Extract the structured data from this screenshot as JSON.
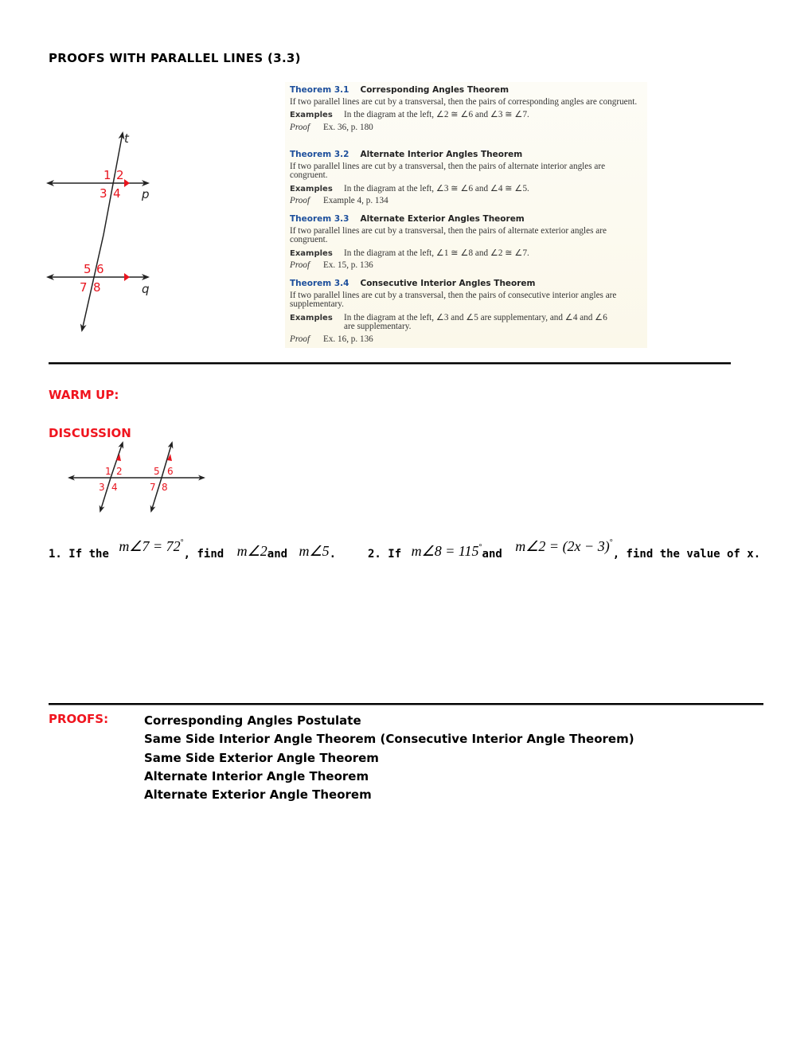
{
  "title": "PROOFS WITH PARALLEL LINES (3.3)",
  "diagram_main": {
    "transversal_label": "t",
    "line_labels": [
      "p",
      "q"
    ],
    "angle_labels": [
      "1",
      "2",
      "3",
      "4",
      "5",
      "6",
      "7",
      "8"
    ]
  },
  "theorems": [
    {
      "number": "Theorem 3.1",
      "name": "Corresponding Angles Theorem",
      "statement": "If two parallel lines are cut by a transversal, then the pairs of corresponding angles are congruent.",
      "examples_label": "Examples",
      "examples": "In the diagram at the left, ∠2 ≅ ∠6 and ∠3 ≅ ∠7.",
      "proof_label": "Proof",
      "proof": "Ex. 36, p. 180"
    },
    {
      "number": "Theorem 3.2",
      "name": "Alternate Interior Angles Theorem",
      "statement": "If two parallel lines are cut by a transversal, then the pairs of alternate interior angles are congruent.",
      "examples_label": "Examples",
      "examples": "In the diagram at the left, ∠3 ≅ ∠6 and ∠4 ≅ ∠5.",
      "proof_label": "Proof",
      "proof": "Example 4, p. 134"
    },
    {
      "number": "Theorem 3.3",
      "name": "Alternate Exterior Angles Theorem",
      "statement": "If two parallel lines are cut by a transversal, then the pairs of alternate exterior angles are congruent.",
      "examples_label": "Examples",
      "examples": "In the diagram at the left, ∠1 ≅ ∠8 and ∠2 ≅ ∠7.",
      "proof_label": "Proof",
      "proof": "Ex. 15, p. 136"
    },
    {
      "number": "Theorem 3.4",
      "name": "Consecutive Interior Angles Theorem",
      "statement": "If two parallel lines are cut by a transversal, then the pairs of consecutive interior angles are supplementary.",
      "examples_label": "Examples",
      "examples": "In the diagram at the left, ∠3 and ∠5 are supplementary, and ∠4 and ∠6 are supplementary.",
      "proof_label": "Proof",
      "proof": "Ex. 16, p. 136"
    }
  ],
  "warm_up": {
    "label": "WARM UP:"
  },
  "discussion": {
    "label": "DISCUSSION",
    "angle_labels": [
      "1",
      "2",
      "3",
      "4",
      "5",
      "6",
      "7",
      "8"
    ]
  },
  "questions": [
    {
      "number": "1.",
      "parts": [
        "If the",
        "m∠7 = 72",
        "°",
        ", find",
        "m∠2",
        "and",
        "m∠5",
        "."
      ]
    },
    {
      "number": "2.",
      "parts": [
        "If",
        "m∠8 = 115",
        "°",
        "and",
        "m∠2 = (2x − 3)",
        "°",
        ", find the value of x."
      ]
    }
  ],
  "proofs": {
    "label": "PROOFS:",
    "items": [
      "Corresponding Angles Postulate",
      "Same Side Interior Angle Theorem (Consecutive Interior Angle Theorem)",
      "Same Side Exterior Angle Theorem",
      "Alternate Interior Angle Theorem",
      "Alternate Exterior Angle Theorem"
    ]
  },
  "colors": {
    "heading_red": "#f0141e",
    "theorem_blue": "#1d4f9c",
    "angle_label_red": "#e8141e"
  }
}
